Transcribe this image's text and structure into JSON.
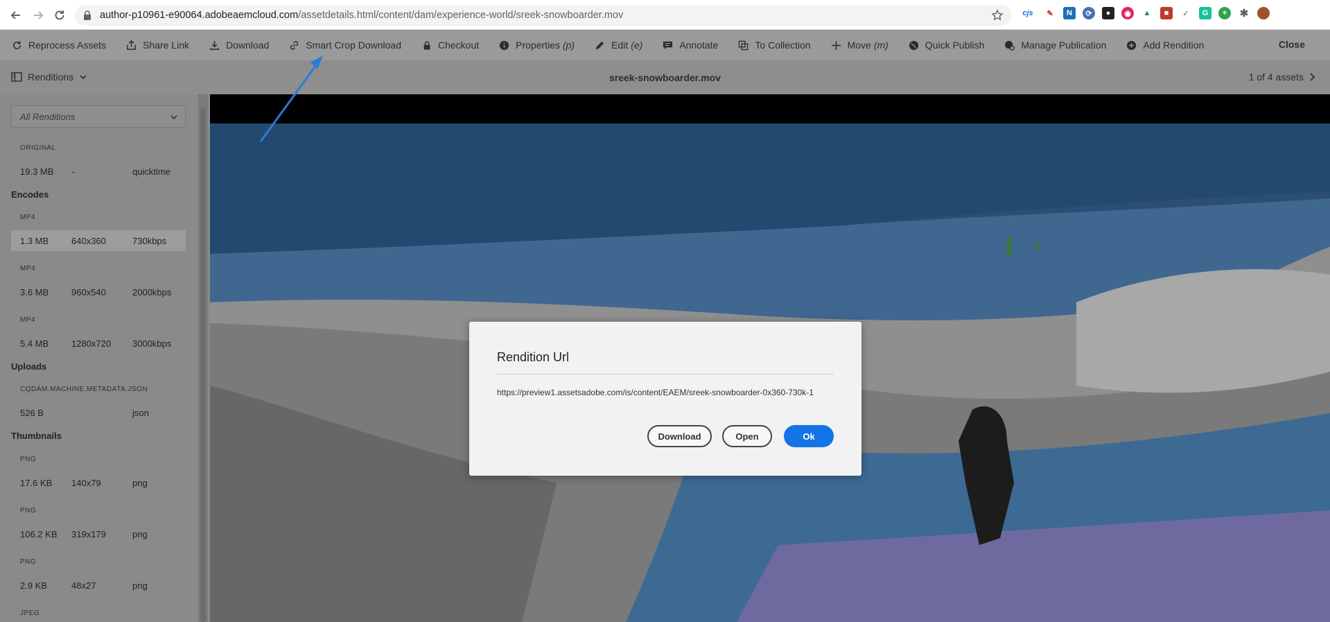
{
  "browser": {
    "url_host": "author-p10961-e90064.adobeaemcloud.com",
    "url_path": "/assetdetails.html/content/dam/experience-world/sreek-snowboarder.mov",
    "ext_cjs": "cjs"
  },
  "toolbar": {
    "reprocess": "Reprocess Assets",
    "share": "Share Link",
    "download": "Download",
    "smart_crop": "Smart Crop Download",
    "checkout": "Checkout",
    "properties": "Properties",
    "properties_hint": "(p)",
    "edit": "Edit",
    "edit_hint": "(e)",
    "annotate": "Annotate",
    "to_collection": "To Collection",
    "move": "Move",
    "move_hint": "(m)",
    "quick_publish": "Quick Publish",
    "manage_publication": "Manage Publication",
    "add_rendition": "Add Rendition",
    "close": "Close"
  },
  "header": {
    "renditions_toggle": "Renditions",
    "asset_name": "sreek-snowboarder.mov",
    "asset_count": "1 of 4 assets"
  },
  "rail": {
    "filter": "All Renditions",
    "original": {
      "type": "ORIGINAL",
      "size": "19.3 MB",
      "dims": "-",
      "fmt": "quicktime"
    },
    "encodes_heading": "Encodes",
    "encodes": [
      {
        "type": "MP4",
        "size": "1.3 MB",
        "dims": "640x360",
        "fmt": "730kbps"
      },
      {
        "type": "MP4",
        "size": "3.6 MB",
        "dims": "960x540",
        "fmt": "2000kbps"
      },
      {
        "type": "MP4",
        "size": "5.4 MB",
        "dims": "1280x720",
        "fmt": "3000kbps"
      }
    ],
    "uploads_heading": "Uploads",
    "uploads": [
      {
        "type": "CQDAM.MACHINE.METADATA.JSON",
        "size": "526 B",
        "dims": "",
        "fmt": "json"
      }
    ],
    "thumbnails_heading": "Thumbnails",
    "thumbnails": [
      {
        "type": "PNG",
        "size": "17.6 KB",
        "dims": "140x79",
        "fmt": "png"
      },
      {
        "type": "PNG",
        "size": "106.2 KB",
        "dims": "319x179",
        "fmt": "png"
      },
      {
        "type": "PNG",
        "size": "2.9 KB",
        "dims": "48x27",
        "fmt": "png"
      }
    ],
    "last_type": "JPEG"
  },
  "modal": {
    "title": "Rendition Url",
    "url": "https://preview1.assetsadobe.com/is/content/EAEM/sreek-snowboarder-0x360-730k-1",
    "download": "Download",
    "open": "Open",
    "ok": "Ok"
  },
  "colors": {
    "primary_button": "#1473e6",
    "annotation_arrow": "#2e7ad8"
  }
}
